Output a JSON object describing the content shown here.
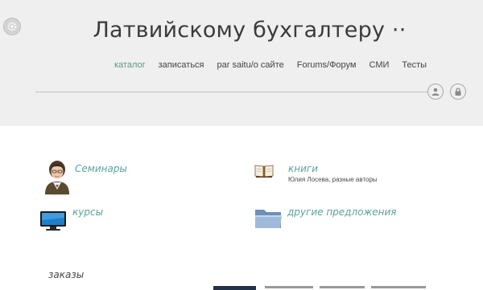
{
  "header": {
    "title": "Латвийскому бухгалтеру ··",
    "nav": [
      {
        "label": "каталог",
        "active": true
      },
      {
        "label": "записаться",
        "active": false
      },
      {
        "label": "par saitu/o сайте",
        "active": false
      },
      {
        "label": "Forums/Форум",
        "active": false
      },
      {
        "label": "СМИ",
        "active": false
      },
      {
        "label": "Тесты",
        "active": false
      }
    ]
  },
  "catalog": {
    "seminars": {
      "title": "Семинары",
      "icon": "teacher-icon"
    },
    "books": {
      "title": "книги",
      "subtitle": "Юлия Лосева, разные авторы",
      "icon": "book-icon"
    },
    "courses": {
      "title": "курсы",
      "icon": "monitor-icon"
    },
    "other": {
      "title": "другие предложения",
      "icon": "folder-icon"
    }
  },
  "footer": {
    "orders_label": "заказы"
  },
  "colors": {
    "accent": "#5aa39a",
    "header_bg": "#efefef",
    "text": "#3b3b3b"
  }
}
